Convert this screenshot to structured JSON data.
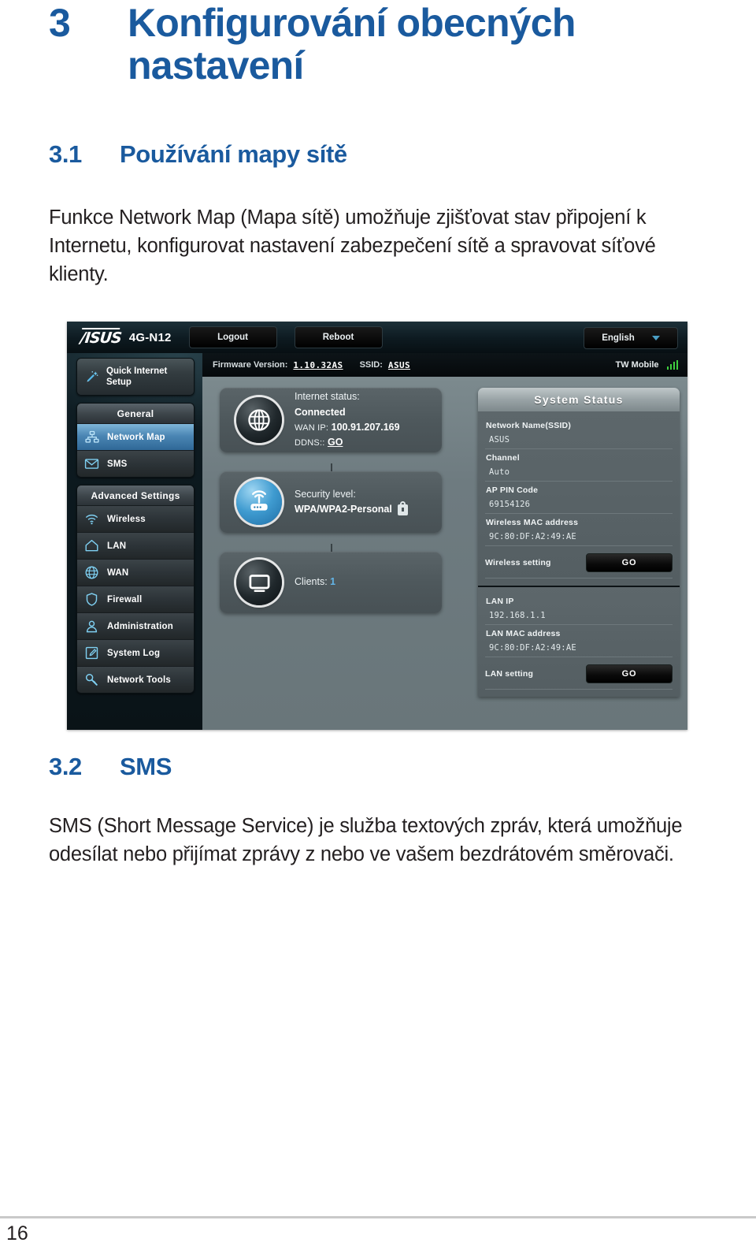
{
  "document": {
    "chapter_number": "3",
    "chapter_title": "Konfigurování obecných nastavení",
    "section_31": {
      "number": "3.1",
      "title": "Používání mapy sítě",
      "paragraph": "Funkce Network Map (Mapa sítě) umožňuje zjišťovat stav připojení k Internetu, konfigurovat nastavení zabezpečení sítě a spravovat síťové klienty."
    },
    "section_32": {
      "number": "3.2",
      "title": "SMS",
      "paragraph": "SMS (Short Message Service) je služba textových zpráv, která umožňuje odesílat nebo přijímat zprávy z nebo ve vašem bezdrátovém směrovači."
    },
    "page_number": "16",
    "heading_color": "#1a5a9e",
    "body_color": "#231f20"
  },
  "router_ui": {
    "header": {
      "brand": "/ISUS",
      "model": "4G-N12",
      "logout_button": "Logout",
      "reboot_button": "Reboot",
      "language": "English"
    },
    "info_strip": {
      "firmware_label": "Firmware Version:",
      "firmware_value": "1.10.32AS",
      "ssid_label": "SSID:",
      "ssid_value": "ASUS",
      "carrier": "TW Mobile",
      "signal_bars": 4
    },
    "sidebar": {
      "quick_setup": "Quick Internet Setup",
      "general_title": "General",
      "general_items": [
        {
          "label": "Network Map",
          "icon": "network-map-icon",
          "active": true
        },
        {
          "label": "SMS",
          "icon": "envelope-icon",
          "active": false
        }
      ],
      "advanced_title": "Advanced Settings",
      "advanced_items": [
        {
          "label": "Wireless",
          "icon": "wifi-icon"
        },
        {
          "label": "LAN",
          "icon": "home-icon"
        },
        {
          "label": "WAN",
          "icon": "globe-icon"
        },
        {
          "label": "Firewall",
          "icon": "shield-icon"
        },
        {
          "label": "Administration",
          "icon": "user-icon"
        },
        {
          "label": "System Log",
          "icon": "edit-document-icon"
        },
        {
          "label": "Network Tools",
          "icon": "wrench-icon"
        }
      ]
    },
    "network_map": {
      "internet": {
        "status_label": "Internet status:",
        "status_value": "Connected",
        "wan_label": "WAN IP:",
        "wan_value": "100.91.207.169",
        "ddns_label": "DDNS::",
        "ddns_action": "GO"
      },
      "security": {
        "label": "Security level:",
        "value": "WPA/WPA2-Personal"
      },
      "clients": {
        "label": "Clients:",
        "count": "1"
      }
    },
    "system_status": {
      "title": "System Status",
      "wireless": [
        {
          "label": "Network Name(SSID)",
          "value": "ASUS"
        },
        {
          "label": "Channel",
          "value": "Auto"
        },
        {
          "label": "AP PIN Code",
          "value": "69154126"
        },
        {
          "label": "Wireless MAC address",
          "value": "9C:80:DF:A2:49:AE"
        }
      ],
      "wireless_action": {
        "label": "Wireless setting",
        "button": "GO"
      },
      "lan": [
        {
          "label": "LAN IP",
          "value": "192.168.1.1"
        },
        {
          "label": "LAN MAC address",
          "value": "9C:80:DF:A2:49:AE"
        }
      ],
      "lan_action": {
        "label": "LAN setting",
        "button": "GO"
      }
    },
    "colors": {
      "accent_blue": "#4b86b4",
      "panel_gray": "#6e7b80",
      "chrome_dark": "#0d1a20"
    }
  }
}
